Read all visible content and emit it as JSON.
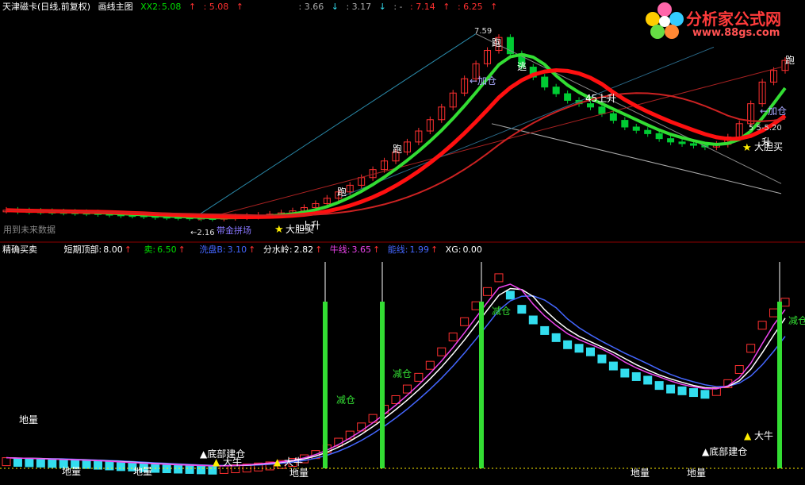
{
  "top": {
    "title": "天津磁卡(日线,前复权)",
    "indicator": "画线主图",
    "xx2_label": "XX2:",
    "xx2_value": "5.08",
    "xx2_alt": ": 5.08",
    "v1": ": 3.66",
    "v2": ": 3.17",
    "v3": ": -",
    "v4": ": 7.14",
    "v5": ": 6.25",
    "future_note": "用到未来数据"
  },
  "middle": {
    "name": "精确买卖",
    "short_top_label": "短期顶部:",
    "short_top": "8.00",
    "sell_label": "卖:",
    "sell": "6.50",
    "wash_label": "洗盘B:",
    "wash": "3.10",
    "watershed_label": "分水岭:",
    "watershed": "2.82",
    "bull_label": "牛线:",
    "bull": "3.65",
    "energy_label": "能线:",
    "energy": "1.99",
    "xg_label": "XG:",
    "xg": "0.00"
  },
  "logo": {
    "name": "分析家公式网",
    "url": "www.88gs.com"
  },
  "annotations_top": {
    "high": "7.59",
    "low": "←2.16",
    "run1": "跑",
    "run2": "跑",
    "run3": "跑",
    "run4": "跑",
    "escape": "逃",
    "add1": "←加仓",
    "add2": "←加仓",
    "rise1": "45上升",
    "rise2": "升",
    "rise3": "上升",
    "bold1": "大胆买",
    "bold2": "大胆买",
    "smart": "带金拼场",
    "range": "5  5-5.20"
  },
  "annotations_bottom": {
    "ground1": "地量",
    "ground2": "地量",
    "ground3": "地量",
    "ground4": "地量",
    "ground5": "地量",
    "ground6": "地量",
    "bottom_build1": "▲底部建仓",
    "bottom_build2": "▲底部建仓",
    "big_bull1": "大牛",
    "big_bull2": "大牛",
    "big_bull3": "大牛",
    "reduce1": "减仓",
    "reduce2": "减仓",
    "reduce3": "减仓",
    "reduce4": "减仓"
  },
  "colors": {
    "background": "#000000",
    "up_candle": "#ff3030",
    "down_candle": "#00cc33",
    "red_ma": "#ff1010",
    "green_ma": "#33dd33",
    "cyan_bar": "#33ddee",
    "magenta": "#ee44ee",
    "blue": "#4466ff",
    "yellow": "#ffee00",
    "white": "#ffffff"
  },
  "chart_data": [
    {
      "type": "candlestick",
      "title": "天津磁卡(日线,前复权)",
      "close_index": [
        2.4,
        2.38,
        2.37,
        2.36,
        2.35,
        2.34,
        2.33,
        2.32,
        2.3,
        2.28,
        2.26,
        2.25,
        2.23,
        2.21,
        2.2,
        2.19,
        2.18,
        2.17,
        2.16,
        2.18,
        2.2,
        2.22,
        2.25,
        2.28,
        2.32,
        2.38,
        2.48,
        2.6,
        2.76,
        2.95,
        3.15,
        3.38,
        3.62,
        3.88,
        4.15,
        4.45,
        4.78,
        5.12,
        5.5,
        5.92,
        6.35,
        6.8,
        7.2,
        7.59,
        7.1,
        6.7,
        6.4,
        6.1,
        5.9,
        5.7,
        5.6,
        5.5,
        5.3,
        5.1,
        4.9,
        4.8,
        4.7,
        4.55,
        4.45,
        4.4,
        4.35,
        4.3,
        4.38,
        4.6,
        5.0,
        5.6,
        6.25,
        6.6,
        6.9
      ],
      "ylim": [
        1.8,
        8.0
      ]
    },
    {
      "type": "bar",
      "name": "精确买卖",
      "series": [
        {
          "name": "牛线",
          "color": "#ffffff"
        },
        {
          "name": "能线",
          "color": "#4466ff"
        },
        {
          "name": "洗盘B",
          "color": "#ee44ee"
        }
      ]
    }
  ]
}
